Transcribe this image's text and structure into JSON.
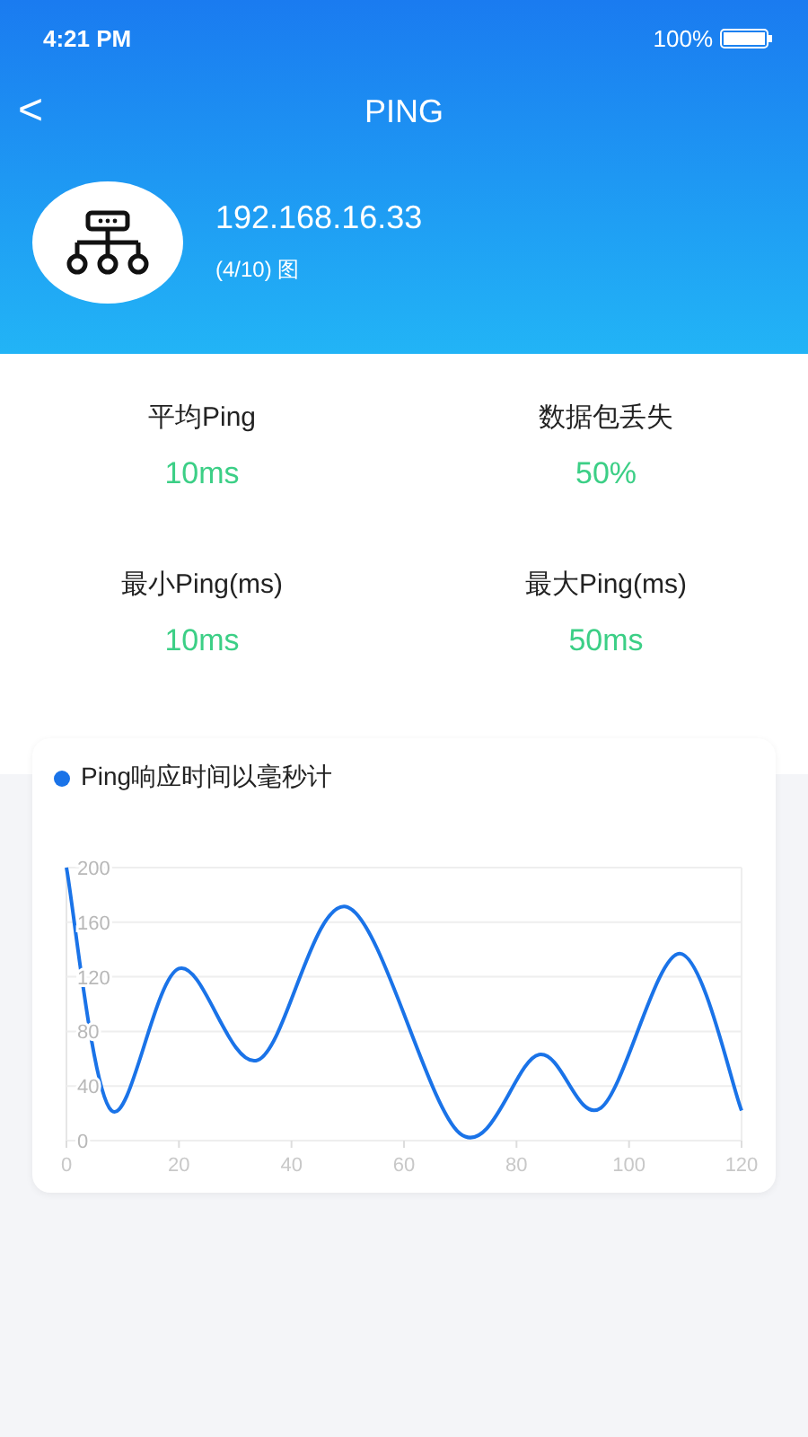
{
  "status_bar": {
    "time": "4:21 PM",
    "battery": "100%"
  },
  "nav": {
    "back": "<",
    "title": "PING"
  },
  "host": {
    "address": "192.168.16.33",
    "subtitle": "(4/10) 图"
  },
  "stats": [
    {
      "label": "平均Ping",
      "value": "10ms"
    },
    {
      "label": "数据包丢失",
      "value": "50%"
    },
    {
      "label": "最小Ping(ms)",
      "value": "10ms"
    },
    {
      "label": "最大Ping(ms)",
      "value": "50ms"
    }
  ],
  "chart": {
    "chart_data": {
      "type": "line",
      "grid": true,
      "x": [
        0,
        8,
        20,
        34,
        50,
        70,
        84,
        95,
        109,
        120
      ],
      "series": [
        {
          "name": "Ping响应时间以毫秒计",
          "color": "#1a73e8",
          "values": [
            200,
            22,
            126,
            59,
            171,
            5,
            63,
            24,
            137,
            22
          ]
        }
      ],
      "xlim": [
        0,
        120
      ],
      "ylim": [
        0,
        200
      ],
      "xticks": [
        0,
        20,
        40,
        60,
        80,
        100,
        120
      ],
      "yticks": [
        0,
        40,
        80,
        120,
        160,
        200
      ]
    }
  }
}
